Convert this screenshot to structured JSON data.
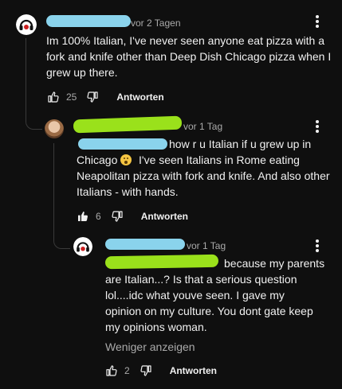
{
  "colors": {
    "background": "#0f0f0f",
    "redaction_blue": "#8ad3ec",
    "redaction_green": "#9ae11b",
    "avatar_accent": "#cc1f1f"
  },
  "comments": [
    {
      "author_redacted": true,
      "avatar": "headphones-avatar",
      "time": "vor 2 Tagen",
      "text": "Im 100% Italian, I've never seen anyone eat pizza with a fork and knife other than Deep Dish Chicago pizza when I grew up there.",
      "likes": "25",
      "like_state": "outline",
      "reply_label": "Antworten"
    },
    {
      "author_redacted": true,
      "avatar": "photo-avatar",
      "time": "vor 1 Tag",
      "text_after_mention": "how r u Italian if u grew up in",
      "text_line2_start": "Chicago",
      "emoji": "surprised-face-emoji",
      "text_rest": "I've seen Italians in Rome eating Neapolitan pizza with fork and knife. And also other Italians - with hands.",
      "likes": "6",
      "like_state": "filled",
      "reply_label": "Antworten"
    },
    {
      "author_redacted": true,
      "avatar": "headphones-avatar",
      "time": "vor 1 Tag",
      "text_after_mention": "because my parents",
      "text_rest": "are Italian...? Is that a serious question lol....idc what youve seen. I gave my opinion on my culture. You dont gate keep my opinions woman.",
      "show_less_label": "Weniger anzeigen",
      "likes": "2",
      "like_state": "outline",
      "reply_label": "Antworten"
    }
  ]
}
